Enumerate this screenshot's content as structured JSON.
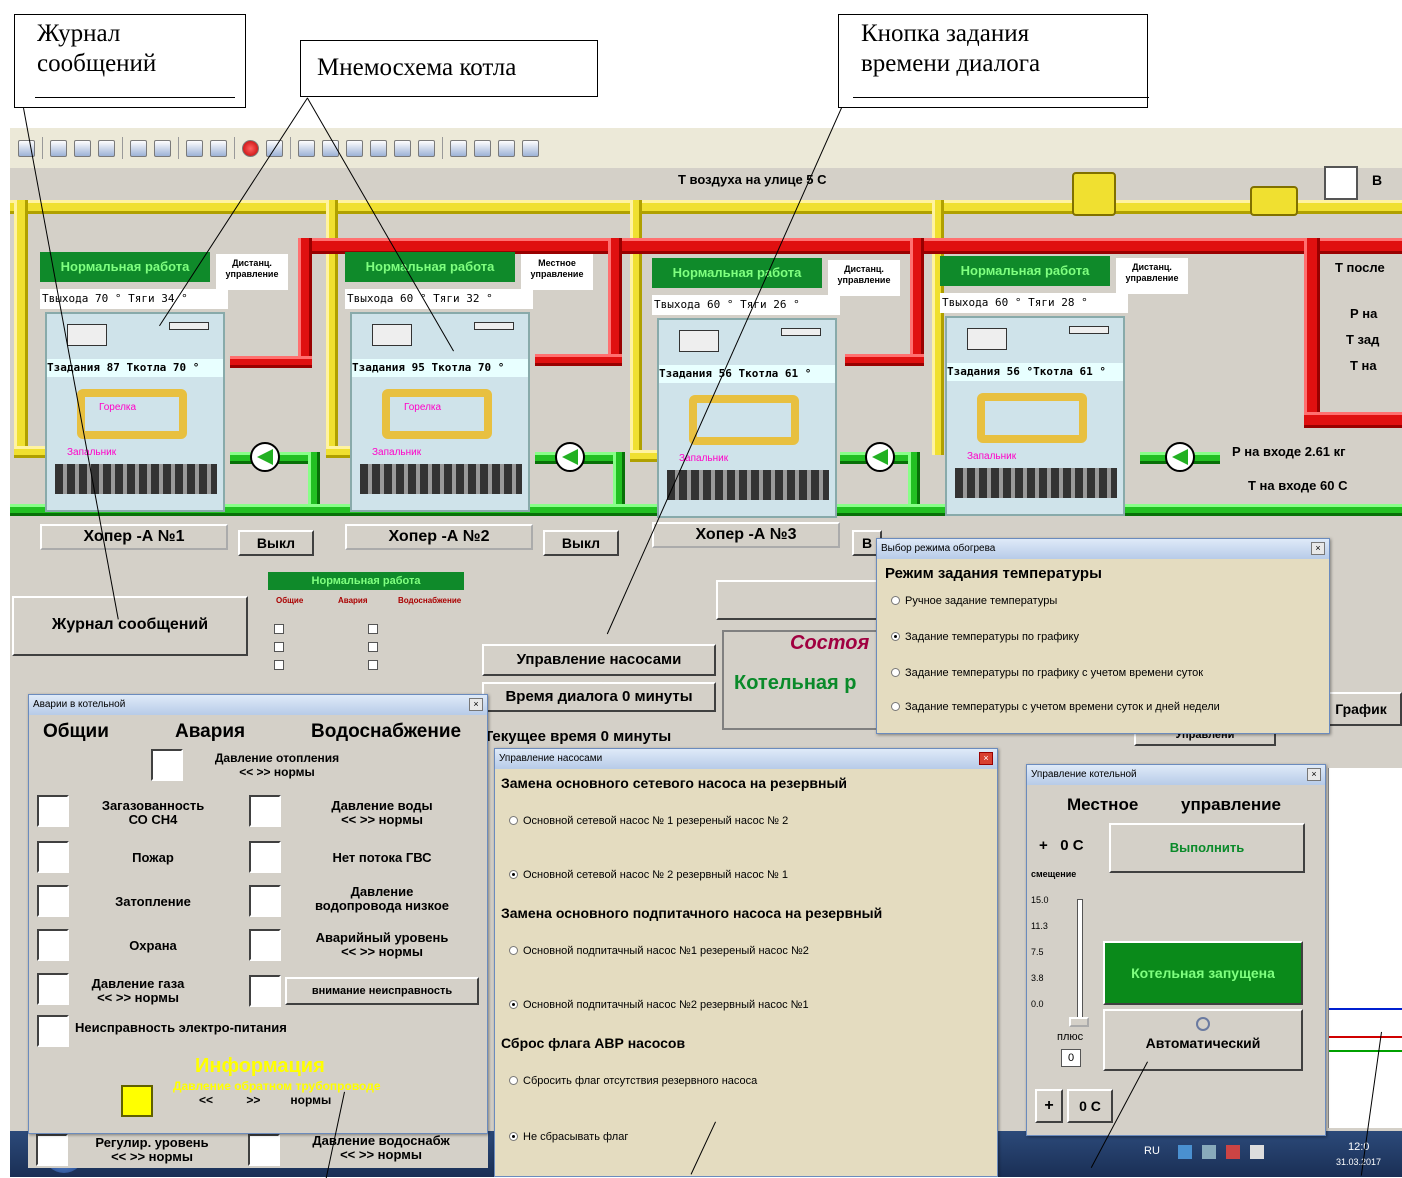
{
  "callouts": {
    "journal": {
      "line1": "Журнал",
      "line2": "сообщений"
    },
    "mnemo": "Мнемосхема котла",
    "dialog_time": {
      "line1": "Кнопка задания",
      "line2": "времени диалога"
    }
  },
  "scada": {
    "outdoor_temp": "Т воздуха на улице  5 С",
    "right_cut_b": "В",
    "t_after": "Т после",
    "p_na": "Р на",
    "t_zad": "Т зад",
    "t_na": "Т на",
    "p_inlet": "Р на входе   2.61 кг",
    "t_inlet": "Т на входе  60  С",
    "journal_button": "Журнал сообщений",
    "pumps_button": "Управление насосами",
    "dialog_time": "Время диалога  0 минуты",
    "current_time": "Текущее время  0 минуты",
    "state_title": "Состоя",
    "boiler_room_state": "Котельная р",
    "graph_button": "График",
    "control_button": "Управлени",
    "mini_status": "Нормальная работа",
    "mini_headers": [
      "Общие",
      "Авария",
      "Водоснабжение"
    ],
    "boilers": [
      {
        "status": "Нормальная работа",
        "mode": "Дистанц. управление",
        "temps": "Твыхода 70 °  Тяги 34 °",
        "task": "Тзадания 87 Ткотла 70 °",
        "burner": "Горелка",
        "igniter": "Запальник",
        "name": "Хопер -А №1",
        "off": "Выкл"
      },
      {
        "status": "Нормальная работа",
        "mode": "Местное управление",
        "temps": "Твыхода 60 °  Тяги 32 °",
        "task": "Тзадания 95 Ткотла 70 °",
        "burner": "Горелка",
        "igniter": "Запальник",
        "name": "Хопер -А №2",
        "off": "Выкл"
      },
      {
        "status": "Нормальная работа",
        "mode": "Дистанц. управление",
        "temps": "Твыхода 60 °  Тяги 26 °",
        "task": "Тзадания 56 Ткотла 61 °",
        "burner": "",
        "igniter": "Запальник",
        "name": "Хопер -А №3",
        "off": "В"
      },
      {
        "status": "Нормальная работа",
        "mode": "Дистанц. управление",
        "temps": "Твыхода 60 °  Тяги 28 °",
        "task": "Тзадания 56 °Ткотла 61 °",
        "burner": "",
        "igniter": "Запальник",
        "name": "",
        "off": ""
      }
    ]
  },
  "alarm_window": {
    "title": "Аварии в котельной",
    "headers": {
      "general": "Общии",
      "alarm": "Авария",
      "water": "Водоснабжение"
    },
    "heating_pressure": {
      "line1": "Давление отопления",
      "line2": "<<    >>   нормы"
    },
    "left": [
      {
        "line1": "Загазованность",
        "line2": "СО  СН4"
      },
      {
        "line1": "Пожар",
        "line2": ""
      },
      {
        "line1": "Затопление",
        "line2": ""
      },
      {
        "line1": "Охрана",
        "line2": ""
      },
      {
        "line1": "Давление газа",
        "line2": "<<  >> нормы"
      }
    ],
    "right": [
      {
        "line1": "Давление воды",
        "line2": "<<    >>    нормы"
      },
      {
        "line1": "Нет потока ГВС",
        "line2": ""
      },
      {
        "line1": "Давление",
        "line2": "водопровода низкое"
      },
      {
        "line1": "Аварийный уровень",
        "line2": "<<    >>    нормы"
      }
    ],
    "fault_button": "внимание неисправность",
    "power_fault": "Неисправность электро-питания",
    "info": "Информация",
    "return_pressure": "Давление обратном трубопроводе",
    "return_limits": "<<          >>         нормы",
    "regulated_level": {
      "line1": "Регулир. уровень",
      "line2": "<<    >>    нормы"
    },
    "water_supply_pressure": {
      "line1": "Давление водоснабж",
      "line2": "<<    >>    нормы"
    }
  },
  "pumps_window": {
    "title": "Управление насосами",
    "sections": [
      {
        "title": "Замена основного сетевого насоса на резервный",
        "options": [
          {
            "label": "Основной сетевой насос № 1 резереный  насос № 2",
            "checked": false
          },
          {
            "label": "Основной сетевой насос № 2 резервный  насос № 1",
            "checked": true
          }
        ]
      },
      {
        "title": "Замена основного  подпитачного насоса на резервный",
        "options": [
          {
            "label": "Основной подпитачный насос №1 резереный  насос №2",
            "checked": false
          },
          {
            "label": "Основной подпитачный насос №2 резервный  насос №1",
            "checked": true
          }
        ]
      },
      {
        "title": "Сброс флага АВР насосов",
        "options": [
          {
            "label": "Сбросить флаг отсутствия резервного насоса",
            "checked": false
          },
          {
            "label": "Не сбрасывать флаг",
            "checked": true
          }
        ]
      }
    ]
  },
  "heating_window": {
    "title": "Выбор режима обогрева",
    "heading": "Режим задания температуры",
    "options": [
      {
        "label": "Ручное задание температуры",
        "checked": false
      },
      {
        "label": "Задание температуры по графику",
        "checked": true
      },
      {
        "label": "Задание температуры по графику с учетом времени  суток",
        "checked": false
      },
      {
        "label": "Задание температуры с учетом времени суток и дней недели",
        "checked": false
      }
    ]
  },
  "boiler_ctrl_window": {
    "title": "Управление котельной",
    "mode_local": "Местное",
    "mode_control": "управление",
    "offset": "+   0 С",
    "offset_label": "смещение",
    "execute_button": "Выполнить",
    "scale": [
      "15.0",
      "11.3",
      "7.5",
      "3.8",
      "0.0"
    ],
    "plus_label": "плюс",
    "slider_value": "0",
    "status_button": "Котельная запущена",
    "auto_button": "Автоматический",
    "plus_button": "+",
    "zero_button": "0 С",
    "slider_level": 0
  },
  "taskbar": {
    "lang": "RU",
    "time": "12:0",
    "date": "31.03.2017"
  },
  "colors": {
    "yellow_pipe": "#f0e030",
    "red_pipe": "#e01010",
    "green_pipe": "#22c022",
    "status_green": "#0f8a2a",
    "window_bg": "#d4d0c8"
  }
}
